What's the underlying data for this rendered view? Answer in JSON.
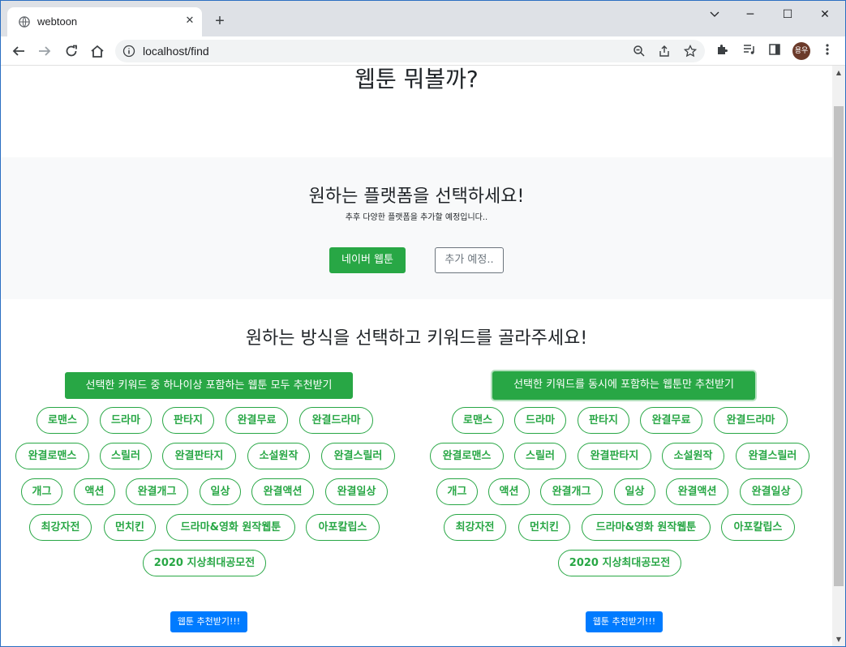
{
  "browser": {
    "tab_title": "webtoon",
    "tab_close": "✕",
    "new_tab": "+",
    "url": "localhost/find",
    "profile_initials": "용우",
    "window_controls": {
      "minimize": "─",
      "maximize": "☐",
      "close": "✕"
    }
  },
  "page": {
    "title": "웹툰 뭐볼까?",
    "platform": {
      "heading": "원하는 플랫폼을 선택하세요!",
      "subtitle": "추후 다양한 플랫폼을 추가할 예정입니다..",
      "naver_button": "네이버 웹툰",
      "coming_soon_button": "추가 예정.."
    },
    "method": {
      "heading": "원하는 방식을 선택하고 키워드를 골라주세요!",
      "left_button": "선택한 키워드 중 하나이상 포함하는 웹툰 모두 추천받기",
      "right_button": "선택한 키워드를 동시에 포함하는 웹툰만 추천받기",
      "submit_button": "웹툰 추천받기!!!"
    },
    "keywords": [
      "로맨스",
      "드라마",
      "판타지",
      "완결무료",
      "완결드라마",
      "완결로맨스",
      "스릴러",
      "완결판타지",
      "소설원작",
      "완결스릴러",
      "개그",
      "액션",
      "완결개그",
      "일상",
      "완결액션",
      "완결일상",
      "최강자전",
      "먼치킨",
      "드라마&영화 원작웹툰",
      "아포칼립스",
      "2020 지상최대공모전"
    ]
  },
  "colors": {
    "success": "#28a745",
    "primary": "#007bff",
    "secondary": "#6c757d",
    "section_bg": "#f8f9fa"
  }
}
